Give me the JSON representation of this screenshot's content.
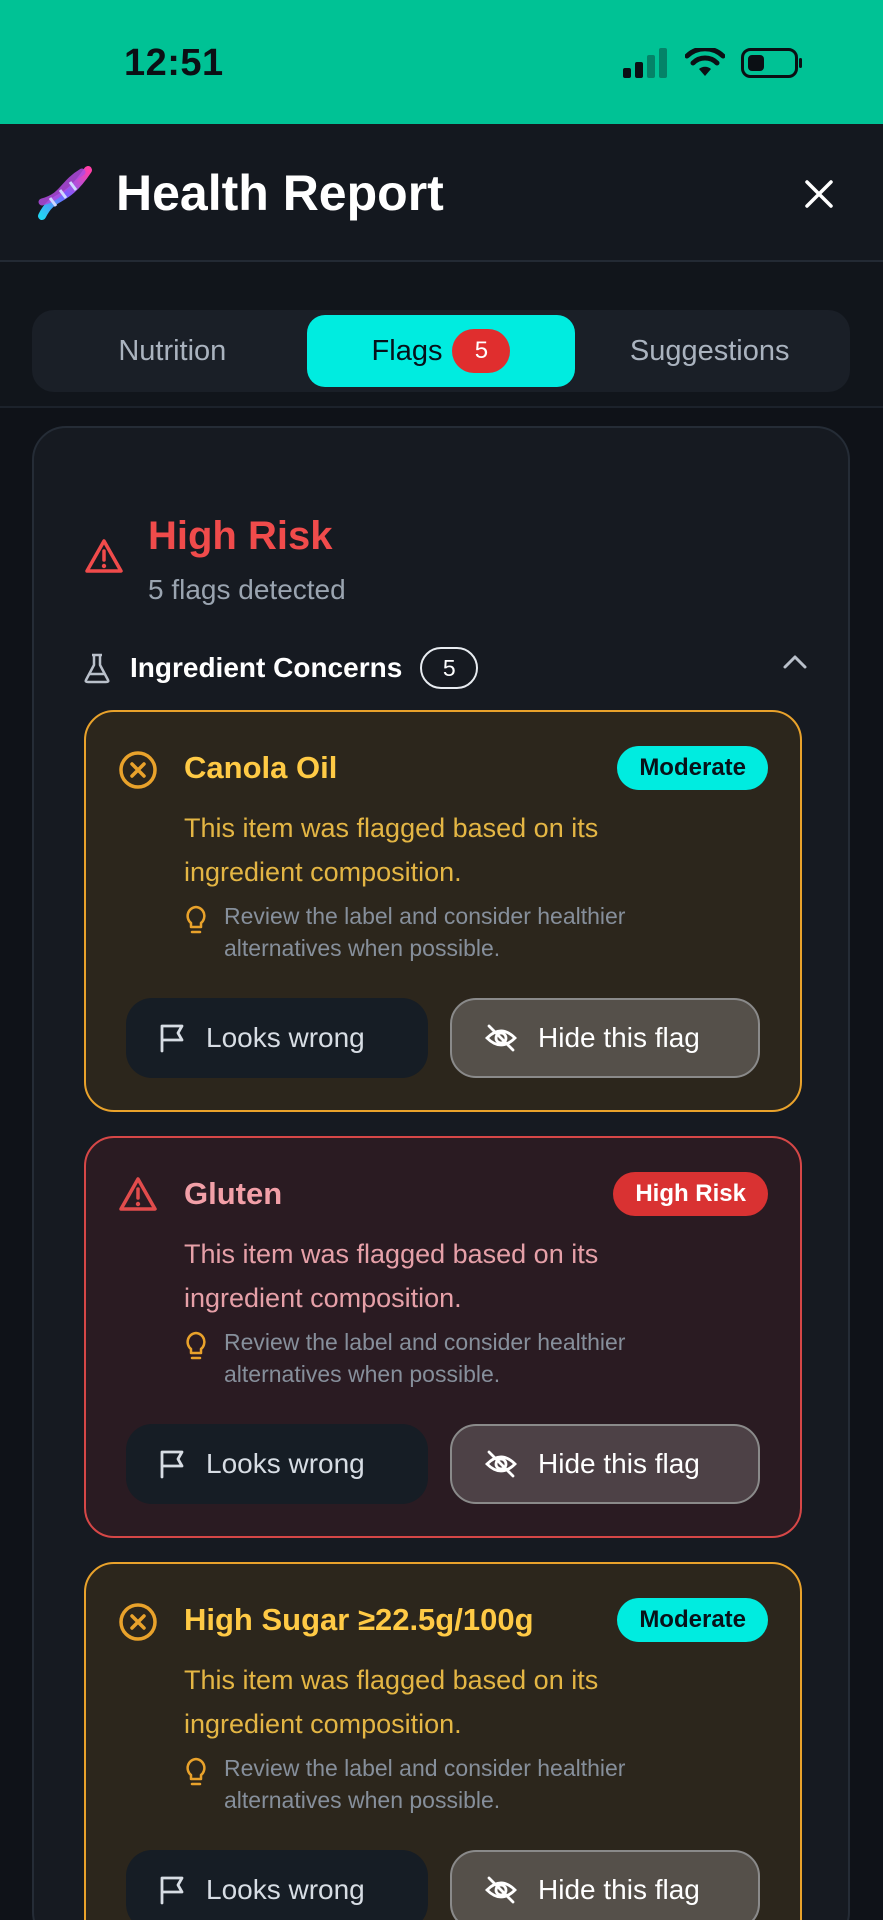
{
  "status_bar": {
    "time": "12:51"
  },
  "header": {
    "title": "Health Report",
    "logo_icon": "dna-icon",
    "close_icon": "close-icon"
  },
  "tabs": [
    {
      "label": "Nutrition",
      "active": false
    },
    {
      "label": "Flags",
      "active": true,
      "badge": "5"
    },
    {
      "label": "Suggestions",
      "active": false
    }
  ],
  "summary": {
    "title": "High Risk",
    "subtitle": "5 flags detected"
  },
  "section": {
    "label": "Ingredient Concerns",
    "count": "5"
  },
  "flags": [
    {
      "title": "Canola Oil",
      "severity": "Moderate",
      "description": "This item was flagged based on its ingredient composition.",
      "tip": "Review the label and consider healthier alternatives when possible.",
      "wrong_label": "Looks wrong",
      "hide_label": "Hide this flag"
    },
    {
      "title": "Gluten",
      "severity": "High Risk",
      "description": "This item was flagged based on its ingredient composition.",
      "tip": "Review the label and consider healthier alternatives when possible.",
      "wrong_label": "Looks wrong",
      "hide_label": "Hide this flag"
    },
    {
      "title": "High Sugar ≥22.5g/100g",
      "severity": "Moderate",
      "description": "This item was flagged based on its ingredient composition.",
      "tip": "Review the label and consider healthier alternatives when possible.",
      "wrong_label": "Looks wrong",
      "hide_label": "Hide this flag"
    }
  ],
  "colors": {
    "status_bar": "#00c295",
    "accent": "#00ece0",
    "high_risk": "#f04b4b",
    "moderate": "#e9a22b"
  }
}
